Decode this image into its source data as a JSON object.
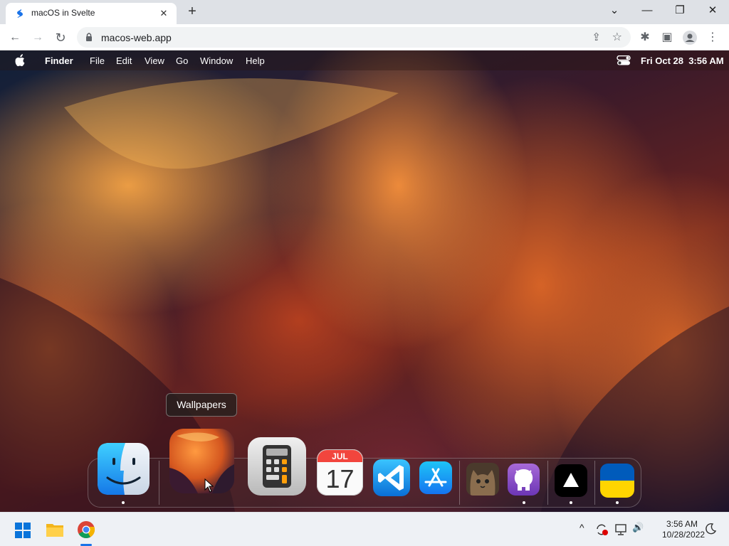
{
  "browser": {
    "tab_title": "macOS in Svelte",
    "tab_close": "✕",
    "new_tab": "+",
    "window_controls": {
      "tab_search": "⌄",
      "minimize": "—",
      "restore": "❐",
      "close": "✕"
    },
    "back": "←",
    "forward": "→",
    "reload": "↻",
    "url": "macos-web.app",
    "share": "⇪",
    "bookmark": "☆",
    "extensions": "✱",
    "sidepanel": "▣",
    "menu": "⋮"
  },
  "menubar": {
    "items": [
      "Finder",
      "File",
      "Edit",
      "View",
      "Go",
      "Window",
      "Help"
    ],
    "date": "Fri Oct 28",
    "time": "3:56 AM"
  },
  "tooltip": "Wallpapers",
  "dock": {
    "apps": [
      {
        "name": "Finder",
        "icon": "finder-icon",
        "running": true
      },
      {
        "name": "Wallpapers",
        "icon": "wallpapers-icon",
        "running": false
      },
      {
        "name": "Calculator",
        "icon": "calculator-icon",
        "running": false
      },
      {
        "name": "Calendar",
        "icon": "calendar-icon",
        "running": false,
        "month": "JUL",
        "day": "17"
      },
      {
        "name": "VS Code",
        "icon": "vscode-icon",
        "running": false
      },
      {
        "name": "App Store",
        "icon": "appstore-icon",
        "running": false
      },
      {
        "name": "Cat",
        "icon": "cat-photo-icon",
        "running": false
      },
      {
        "name": "GitHub",
        "icon": "github-icon",
        "running": true
      },
      {
        "name": "Vercel",
        "icon": "vercel-icon",
        "running": true
      },
      {
        "name": "Ukraine",
        "icon": "ukraine-flag-icon",
        "running": true
      }
    ]
  },
  "taskbar": {
    "time": "3:56 AM",
    "date": "10/28/2022",
    "tray_chevron": "^",
    "volume": "🔊"
  },
  "colors": {
    "chrome_tab_bg": "#dee1e6",
    "accent_blue": "#1a73e8",
    "ukraine_blue": "#005bbb",
    "ukraine_yellow": "#ffd500"
  }
}
